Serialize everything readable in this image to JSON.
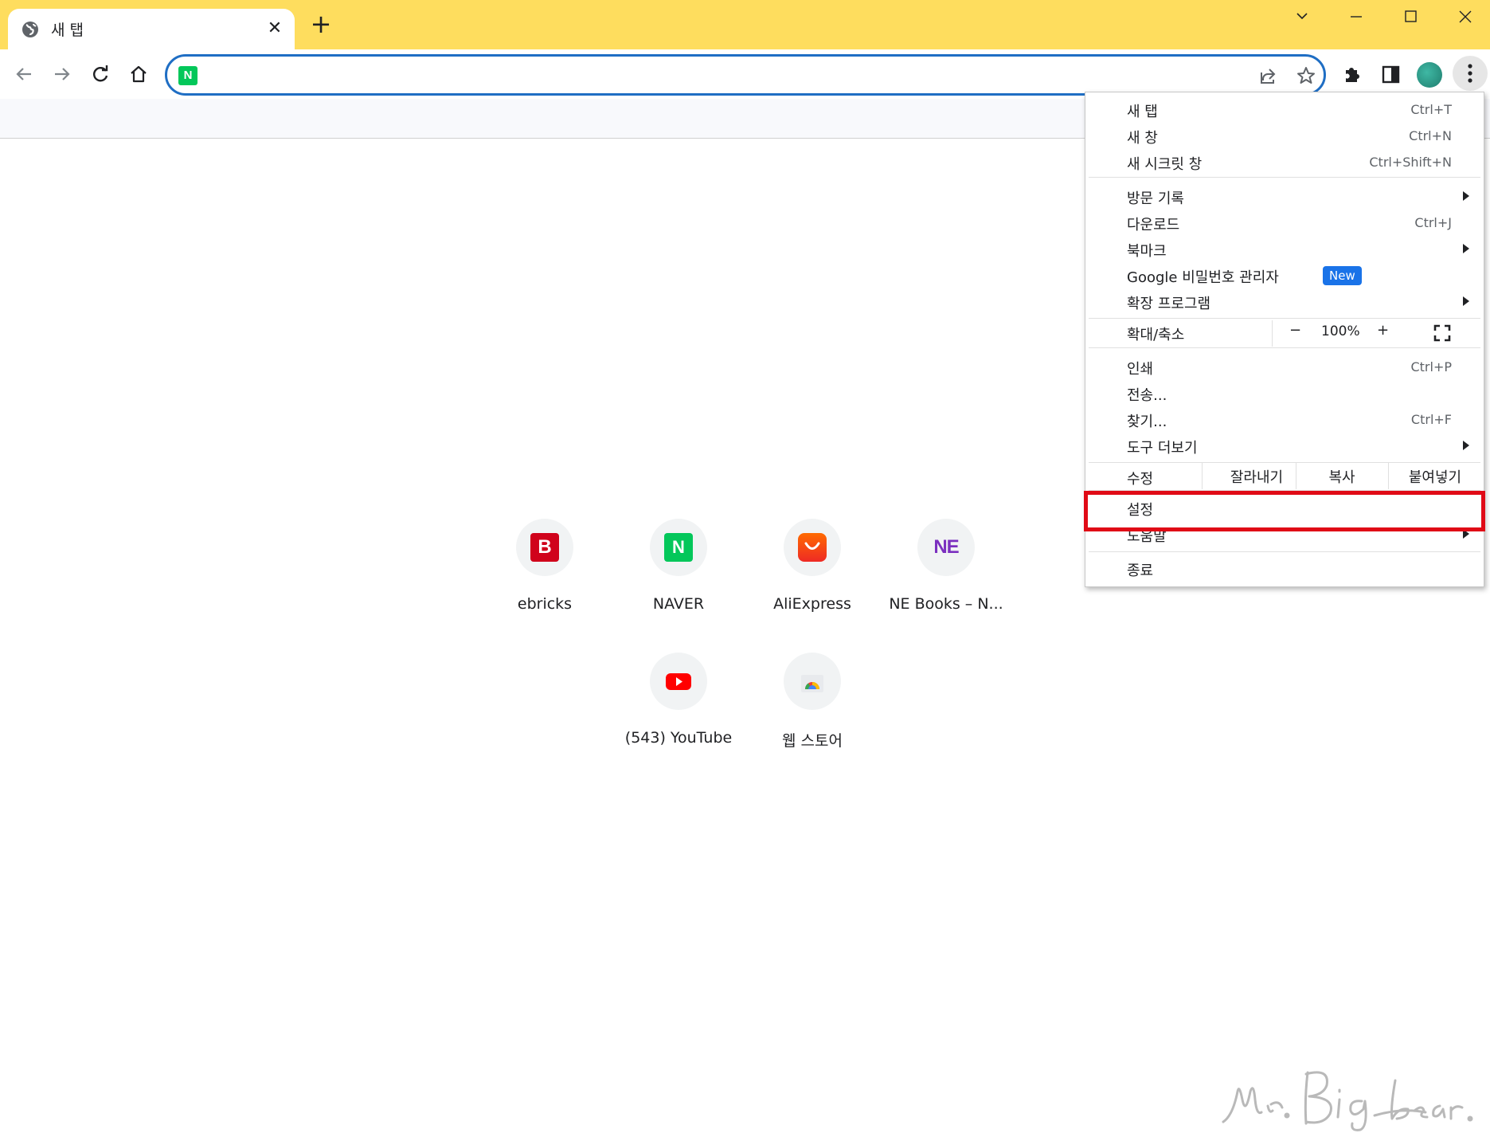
{
  "tab": {
    "title": "새 탭",
    "close_glyph": "✕",
    "icon": "globe-icon"
  },
  "new_tab_glyph": "+",
  "omnibox": {
    "value": "",
    "favicon_letter": "N"
  },
  "colors": {
    "titlebar": "#fedd5e",
    "accent": "#1f6ec4",
    "highlight": "#e00a16",
    "new_badge": "#1a73e8"
  },
  "shortcuts": [
    {
      "label": "ebricks",
      "letter": "B",
      "color": "#d0021b"
    },
    {
      "label": "NAVER",
      "letter": "N",
      "color": "#03c75a"
    },
    {
      "label": "AliExpress",
      "letter": "",
      "color": "#ff4700"
    },
    {
      "label": "NE Books – N...",
      "letter": "NE",
      "color": "#7b2fbf"
    },
    {
      "label": "(543) YouTube",
      "letter": "",
      "color": "#ff0000"
    },
    {
      "label": "웹 스토어",
      "letter": "",
      "color": "#4285f4"
    }
  ],
  "menu": {
    "new_tab": {
      "label": "새 탭",
      "shortcut": "Ctrl+T"
    },
    "new_window": {
      "label": "새 창",
      "shortcut": "Ctrl+N"
    },
    "incognito": {
      "label": "새 시크릿 창",
      "shortcut": "Ctrl+Shift+N"
    },
    "history": {
      "label": "방문 기록"
    },
    "downloads": {
      "label": "다운로드",
      "shortcut": "Ctrl+J"
    },
    "bookmarks": {
      "label": "북마크"
    },
    "password_manager": {
      "label": "Google 비밀번호 관리자",
      "badge": "New"
    },
    "extensions": {
      "label": "확장 프로그램"
    },
    "zoom": {
      "label": "확대/축소",
      "minus": "−",
      "level": "100%",
      "plus": "+"
    },
    "print": {
      "label": "인쇄",
      "shortcut": "Ctrl+P"
    },
    "cast": {
      "label": "전송..."
    },
    "find": {
      "label": "찾기...",
      "shortcut": "Ctrl+F"
    },
    "more_tools": {
      "label": "도구 더보기"
    },
    "edit": {
      "label": "수정",
      "cut": "잘라내기",
      "copy": "복사",
      "paste": "붙여넣기"
    },
    "settings": {
      "label": "설정"
    },
    "help": {
      "label": "도움말"
    },
    "exit": {
      "label": "종료"
    }
  },
  "watermark": "Mr. Big bear."
}
